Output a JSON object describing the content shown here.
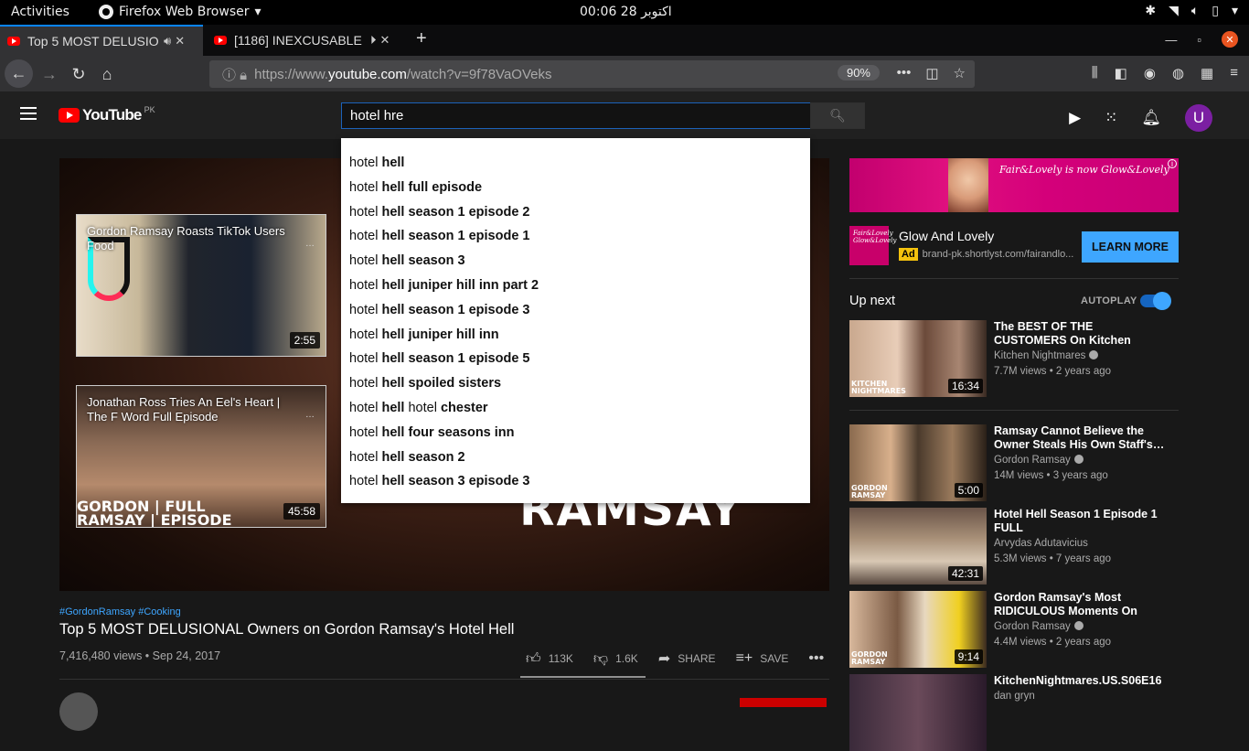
{
  "system_bar": {
    "activities": "Activities",
    "app_name": "Firefox Web Browser",
    "clock": "00:06  28 اکتوبر"
  },
  "tabs": [
    {
      "title": "Top 5 MOST DELUSIO",
      "active": true,
      "audio_icon": "speaker-icon"
    },
    {
      "title": "[1186] INEXCUSABLE",
      "active": false,
      "audio_icon": "play-icon"
    }
  ],
  "address_bar": {
    "url_prefix": "https://www.",
    "url_host": "youtube.com",
    "url_path": "/watch?v=9f78VaOVeks",
    "zoom": "90%"
  },
  "youtube": {
    "logo": "YouTube",
    "region": "PK",
    "search_value": "hotel hre",
    "avatar_letter": "U"
  },
  "suggestions": [
    {
      "prefix": "hotel ",
      "bold": "hell",
      "suffix": ""
    },
    {
      "prefix": "hotel ",
      "bold": "hell full episode",
      "suffix": ""
    },
    {
      "prefix": "hotel ",
      "bold": "hell season 1 episode 2",
      "suffix": ""
    },
    {
      "prefix": "hotel ",
      "bold": "hell season 1 episode 1",
      "suffix": ""
    },
    {
      "prefix": "hotel ",
      "bold": "hell season 3",
      "suffix": ""
    },
    {
      "prefix": "hotel ",
      "bold": "hell juniper hill inn part 2",
      "suffix": ""
    },
    {
      "prefix": "hotel ",
      "bold": "hell season 1 episode 3",
      "suffix": ""
    },
    {
      "prefix": "hotel ",
      "bold": "hell juniper hill inn",
      "suffix": ""
    },
    {
      "prefix": "hotel ",
      "bold": "hell season 1 episode 5",
      "suffix": ""
    },
    {
      "prefix": "hotel ",
      "bold": "hell spoiled sisters",
      "suffix": ""
    },
    {
      "prefix": "hotel ",
      "bold": "hell",
      "mid": " hotel ",
      "bold2": "chester"
    },
    {
      "prefix": "hotel ",
      "bold": "hell four seasons inn",
      "suffix": ""
    },
    {
      "prefix": "hotel ",
      "bold": "hell season 2",
      "suffix": ""
    },
    {
      "prefix": "hotel ",
      "bold": "hell season 3 episode 3",
      "suffix": ""
    }
  ],
  "player": {
    "overlay_text": "RAMSAY",
    "endcards": [
      {
        "title": "Gordon Ramsay Roasts TikTok Users Food",
        "duration": "2:55",
        "brand": "BEST TIKTOK"
      },
      {
        "title": "Jonathan Ross Tries An Eel's Heart | The F Word Full Episode",
        "duration": "45:58",
        "brand_line1": "GORDON | FULL",
        "brand_line2": "RAMSAY | EPISODE"
      }
    ]
  },
  "video": {
    "hashtags": "#GordonRamsay #Cooking",
    "title": "Top 5 MOST DELUSIONAL Owners on Gordon Ramsay's Hotel Hell",
    "meta": "7,416,480 views • Sep 24, 2017",
    "likes": "113K",
    "dislikes": "1.6K",
    "share": "SHARE",
    "save": "SAVE"
  },
  "ad": {
    "banner_brand": "Fair&Lovely is now Glow&Lovely",
    "thumb_text": "Fair&Lovely Glow&Lovely",
    "title": "Glow And Lovely",
    "label": "Ad",
    "url": "brand-pk.shortlyst.com/fairandlo...",
    "cta": "LEARN MORE"
  },
  "sidebar": {
    "up_next": "Up next",
    "autoplay": "AUTOPLAY",
    "recommendations": [
      {
        "title": "The BEST OF THE CUSTOMERS On Kitchen Nightmares",
        "channel": "Kitchen Nightmares",
        "verified": true,
        "views": "7.7M views • 2 years ago",
        "duration": "16:34",
        "brand": "KITCHEN NIGHTMARES"
      },
      {
        "title": "Ramsay Cannot Believe the Owner Steals His Own Staff's…",
        "channel": "Gordon Ramsay",
        "verified": true,
        "views": "14M views • 3 years ago",
        "duration": "5:00",
        "brand": "GORDON RAMSAY"
      },
      {
        "title": "Hotel Hell Season 1 Episode 1 FULL",
        "channel": "Arvydas Adutavicius",
        "verified": false,
        "views": "5.3M views • 7 years ago",
        "duration": "42:31",
        "brand": ""
      },
      {
        "title": "Gordon Ramsay's Most RIDICULOUS Moments On Hot…",
        "channel": "Gordon Ramsay",
        "verified": true,
        "views": "4.4M views • 2 years ago",
        "duration": "9:14",
        "brand": "GORDON RAMSAY"
      },
      {
        "title": "KitchenNightmares.US.S06E16",
        "channel": "dan gryn",
        "verified": false,
        "views": "",
        "duration": "",
        "brand": ""
      }
    ]
  }
}
